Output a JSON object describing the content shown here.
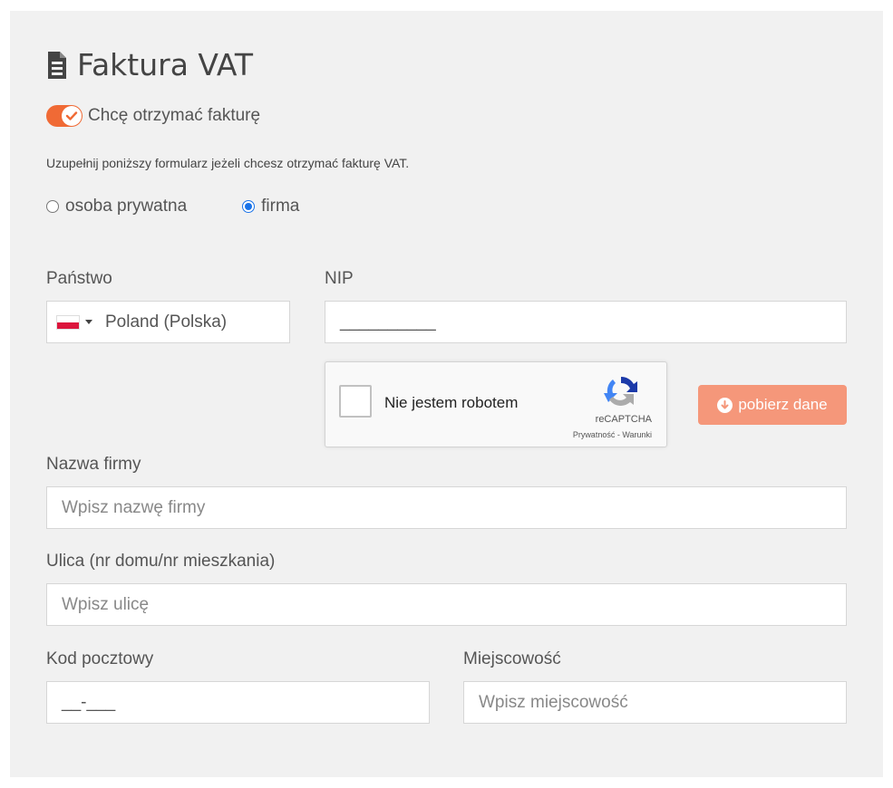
{
  "header": {
    "title": "Faktura VAT",
    "icon": "document-icon"
  },
  "invoice_toggle": {
    "label": "Chcę otrzymać fakturę",
    "checked": true,
    "accent": "#f06a35"
  },
  "hint": "Uzupełnij poniższy formularz jeżeli chcesz otrzymać fakturę VAT.",
  "customer_type": {
    "options": [
      {
        "label": "osoba prywatna",
        "checked": false
      },
      {
        "label": "firma",
        "checked": true
      }
    ]
  },
  "country": {
    "label": "Państwo",
    "value": "Poland (Polska)"
  },
  "nip": {
    "label": "NIP",
    "value": "__________"
  },
  "captcha": {
    "text": "Nie jestem robotem",
    "brand": "reCAPTCHA",
    "links": "Prywatność - Warunki"
  },
  "fetch_button": {
    "label": "pobierz dane",
    "color": "#f5977a"
  },
  "company": {
    "label": "Nazwa firmy",
    "placeholder": "Wpisz nazwę firmy"
  },
  "street": {
    "label": "Ulica (nr domu/nr mieszkania)",
    "placeholder": "Wpisz ulicę"
  },
  "postal": {
    "label": "Kod pocztowy",
    "value": "__-___"
  },
  "city": {
    "label": "Miejscowość",
    "placeholder": "Wpisz miejscowość"
  }
}
